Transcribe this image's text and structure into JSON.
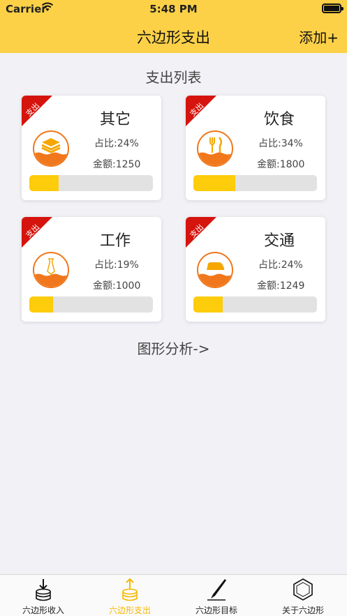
{
  "status_bar": {
    "carrier": "Carrier",
    "time": "5:48 PM"
  },
  "nav": {
    "title": "六边形支出",
    "add_label": "添加+"
  },
  "section_title": "支出列表",
  "cards": [
    {
      "tag": "支出",
      "name": "其它",
      "ratio_text": "占比:24%",
      "amount_text": "金额:1250",
      "ratio": 0.24,
      "icon": "layers-icon"
    },
    {
      "tag": "支出",
      "name": "饮食",
      "ratio_text": "占比:34%",
      "amount_text": "金额:1800",
      "ratio": 0.34,
      "icon": "fork-knife-icon"
    },
    {
      "tag": "支出",
      "name": "工作",
      "ratio_text": "占比:19%",
      "amount_text": "金额:1000",
      "ratio": 0.19,
      "icon": "tie-icon"
    },
    {
      "tag": "支出",
      "name": "交通",
      "ratio_text": "占比:24%",
      "amount_text": "金额:1249",
      "ratio": 0.24,
      "icon": "car-icon"
    }
  ],
  "analysis_link": "图形分析->",
  "tabs": [
    {
      "label": "六边形收入",
      "icon": "coins-in-icon",
      "active": false
    },
    {
      "label": "六边形支出",
      "icon": "coins-out-icon",
      "active": true
    },
    {
      "label": "六边形目标",
      "icon": "pen-icon",
      "active": false
    },
    {
      "label": "关于六边形",
      "icon": "hexagon-icon",
      "active": false
    }
  ],
  "colors": {
    "header": "#fdd147",
    "accent": "#fdcc0a",
    "ribbon": "#d5140d",
    "icon_ring": "#f0771c"
  }
}
